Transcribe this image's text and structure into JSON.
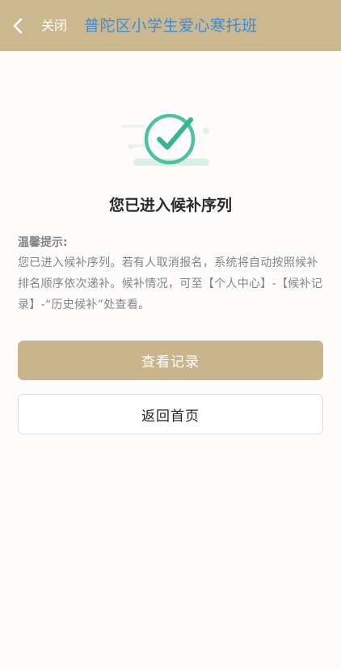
{
  "header": {
    "back_icon": "chevron-left-icon",
    "close_label": "关闭",
    "title": "普陀区小学生爱心寒托班",
    "background_color": "#cbb88e",
    "title_color": "#3a8be0"
  },
  "result": {
    "icon": "success-check-icon",
    "title": "您已进入候补序列"
  },
  "tip": {
    "label": "温馨提示:",
    "body": "您已进入候补序列。若有人取消报名，系统将自动按照候补排名顺序依次递补。候补情况，可至【个人中心】-【候补记录】-“历史候补”处查看。"
  },
  "actions": {
    "primary_label": "查看记录",
    "secondary_label": "返回首页",
    "primary_color": "#c9b58b"
  }
}
